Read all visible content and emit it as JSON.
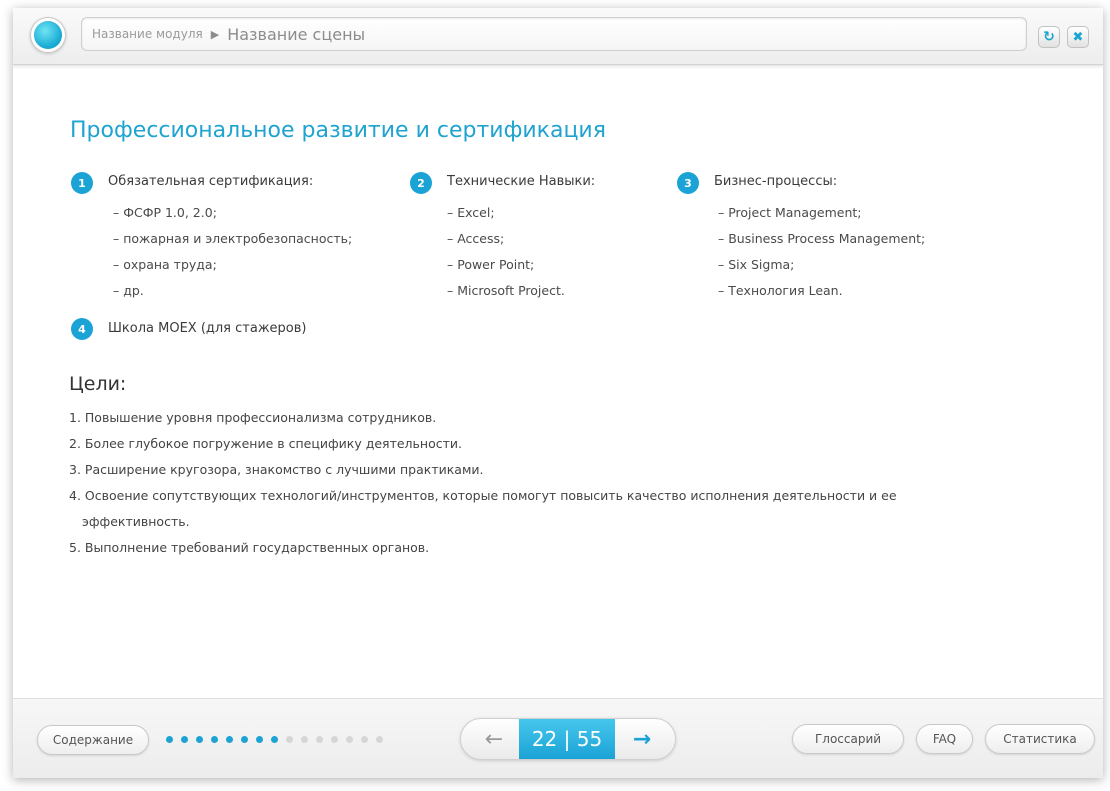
{
  "header": {
    "module_name": "Название модуля",
    "separator": "▶",
    "scene_name": "Название сцены",
    "refresh_icon": "refresh-icon",
    "close_icon": "close-icon"
  },
  "main": {
    "title": "Профессиональное развитие и сертификация",
    "columns": [
      {
        "number": "1",
        "heading": "Обязательная сертификация:",
        "items": [
          "– ФСФР 1.0, 2.0;",
          "– пожарная и электробезопасность;",
          "– охрана труда;",
          "– др."
        ]
      },
      {
        "number": "2",
        "heading": "Технические Навыки:",
        "items": [
          "– Excel;",
          "– Access;",
          "– Power Point;",
          "– Microsoft Project."
        ]
      },
      {
        "number": "3",
        "heading": "Бизнес-процессы:",
        "items": [
          "– Project Management;",
          "– Business Process Management;",
          "– Six Sigma;",
          "– Технология Lean."
        ]
      }
    ],
    "item4": {
      "number": "4",
      "heading": "Школа MOEX (для стажеров)"
    },
    "goals_title": "Цели:",
    "goals": [
      "1. Повышение уровня профессионализма сотрудников.",
      "2. Более глубокое погружение в специфику деятельности.",
      "3. Расширение кругозора, знакомство с лучшими практиками.",
      "4. Освоение сопутствующих технологий/инструментов, которые помогут повысить качество исполнения деятельности и ее эффективность.",
      "5. Выполнение требований государственных органов."
    ]
  },
  "footer": {
    "contents_label": "Содержание",
    "progress_dots": {
      "total": 15,
      "completed": 8
    },
    "pager": {
      "current": 22,
      "total": 55,
      "text": "22 | 55",
      "prev_icon": "arrow-left-icon",
      "next_icon": "arrow-right-icon"
    },
    "glossary_label": "Глоссарий",
    "faq_label": "FAQ",
    "stats_label": "Статистика"
  },
  "colors": {
    "accent": "#1ba3d6",
    "title": "#1fa3cf",
    "text": "#444444"
  }
}
